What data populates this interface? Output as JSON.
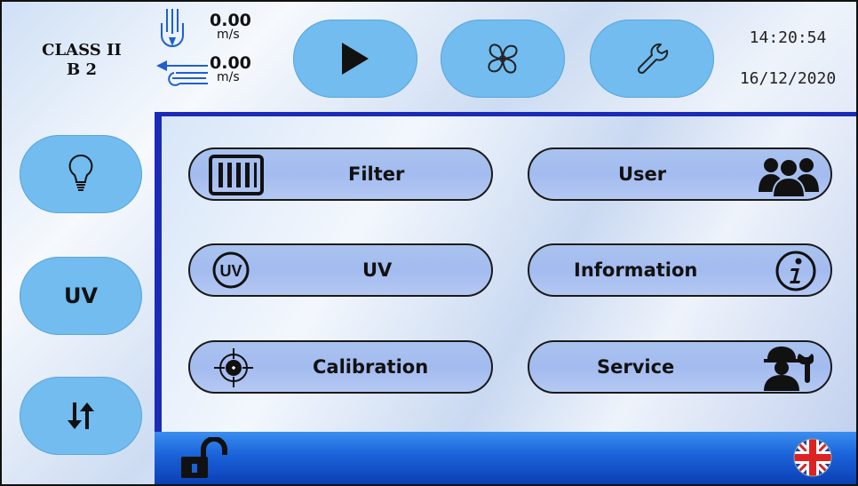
{
  "header": {
    "class_line1": "CLASS II",
    "class_line2": "B 2",
    "downflow": {
      "value": "0.00",
      "unit": "m/s",
      "icon": "downflow-icon"
    },
    "inflow": {
      "value": "0.00",
      "unit": "m/s",
      "icon": "inflow-icon"
    },
    "buttons": [
      {
        "icon": "play-icon"
      },
      {
        "icon": "fan-icon"
      },
      {
        "icon": "wrench-icon"
      }
    ],
    "time": "14:20:54",
    "date": "16/12/2020"
  },
  "sidebar": {
    "light": {
      "icon": "lightbulb-icon"
    },
    "uv_label": "UV",
    "sash": {
      "icon": "up-down-arrows-icon"
    }
  },
  "menu": {
    "filter": "Filter",
    "uv": "UV",
    "uv_icon_text": "UV",
    "calibration": "Calibration",
    "user": "User",
    "information": "Information",
    "service": "Service"
  },
  "footer": {
    "lock_icon": "unlocked-padlock-icon",
    "language_icon": "uk-flag-icon"
  },
  "colors": {
    "button_blue": "#72bcef",
    "panel_border": "#1b2bb8",
    "menu_pill": "#a9c3ef",
    "footer_blue": "#1a62d8"
  }
}
